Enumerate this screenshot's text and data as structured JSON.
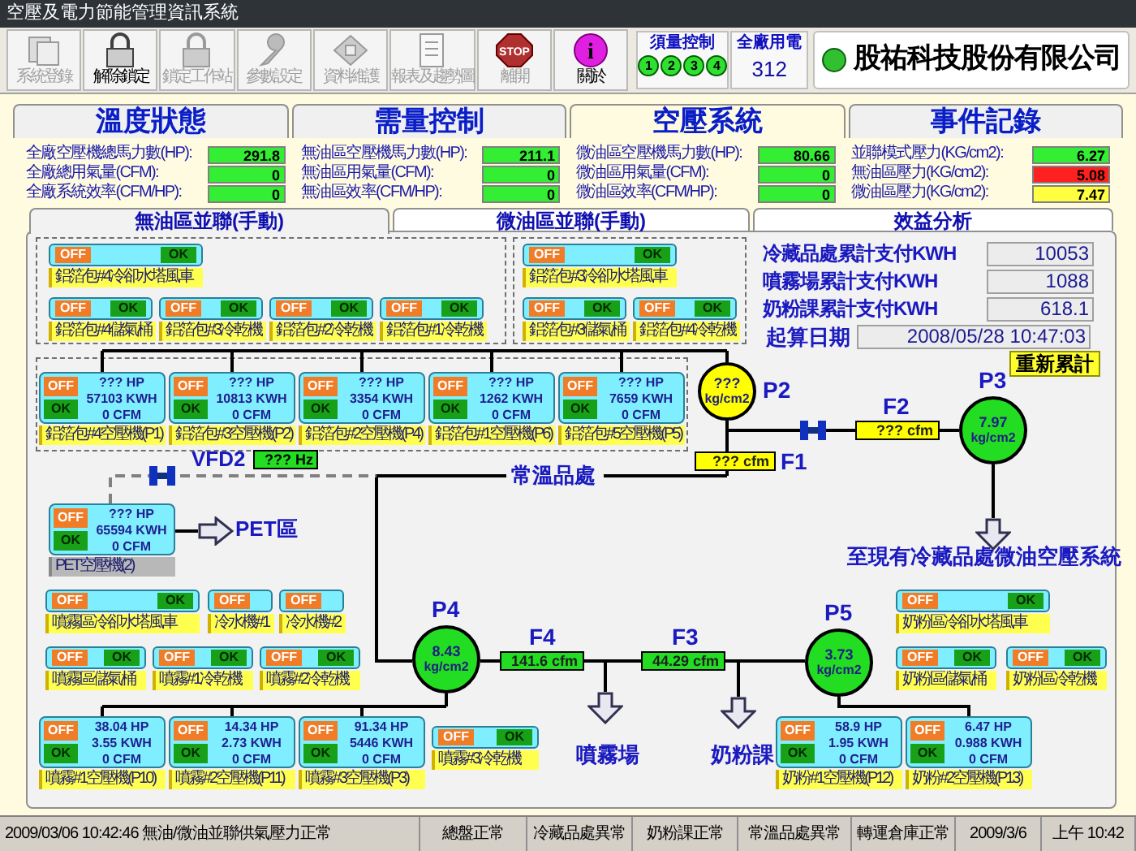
{
  "window": {
    "title": "空壓及電力節能管理資訊系統"
  },
  "toolbar": [
    {
      "label": "系統登錄",
      "kind": "documents",
      "disabled": true
    },
    {
      "label": "解除鎖定",
      "kind": "lock",
      "disabled": false
    },
    {
      "label": "鎖定工作站",
      "kind": "lock",
      "disabled": true
    },
    {
      "label": "參數設定",
      "kind": "wrench",
      "disabled": true
    },
    {
      "label": "資料維護",
      "kind": "disk",
      "disabled": true
    },
    {
      "label": "報表及趨勢圖",
      "kind": "page",
      "disabled": true
    },
    {
      "label": "離開",
      "kind": "stop",
      "icon_text": "STOP",
      "disabled": true
    },
    {
      "label": "關於",
      "kind": "info",
      "icon_text": "i",
      "disabled": false
    }
  ],
  "demand_control": {
    "label": "須量控制",
    "stages": [
      {
        "label": "1",
        "on": true
      },
      {
        "label": "2",
        "on": true
      },
      {
        "label": "3",
        "on": true
      },
      {
        "label": "4",
        "on": true
      }
    ]
  },
  "plant_power": {
    "label": "全廠用電",
    "value": "312"
  },
  "company": {
    "name": "股祐科技股份有限公司"
  },
  "tabs": [
    {
      "label": "溫度狀態",
      "selected": false
    },
    {
      "label": "需量控制",
      "selected": false
    },
    {
      "label": "空壓系統",
      "selected": true
    },
    {
      "label": "事件記錄",
      "selected": false
    }
  ],
  "metrics": [
    [
      {
        "label": "全廠空壓機總馬力數(HP):",
        "value": "291.8",
        "color": "#33ee33"
      },
      {
        "label": "全廠總用氣量(CFM):",
        "value": "0",
        "color": "#33ee33"
      },
      {
        "label": "全廠系統效率(CFM/HP):",
        "value": "0",
        "color": "#33ee33"
      }
    ],
    [
      {
        "label": "無油區空壓機馬力數(HP):",
        "value": "211.1",
        "color": "#33ee33"
      },
      {
        "label": "無油區用氣量(CFM):",
        "value": "0",
        "color": "#33ee33"
      },
      {
        "label": "無油區效率(CFM/HP):",
        "value": "0",
        "color": "#33ee33"
      }
    ],
    [
      {
        "label": "微油區空壓機馬力數(HP):",
        "value": "80.66",
        "color": "#33ee33"
      },
      {
        "label": "微油區用氣量(CFM):",
        "value": "0",
        "color": "#33ee33"
      },
      {
        "label": "微油區效率(CFM/HP):",
        "value": "0",
        "color": "#33ee33"
      }
    ],
    [
      {
        "label": "並聯模式壓力(KG/cm2):",
        "value": "6.27",
        "color": "#33ee33"
      },
      {
        "label": "無油區壓力(KG/cm2):",
        "value": "5.08",
        "color": "#ff2020"
      },
      {
        "label": "微油區壓力(KG/cm2):",
        "value": "7.47",
        "color": "#ffff40"
      }
    ]
  ],
  "subtabs": [
    {
      "label": "無油區並聯(手動)",
      "selected": true
    },
    {
      "label": "微油區並聯(手動)",
      "selected": false
    },
    {
      "label": "效益分析",
      "selected": false
    }
  ],
  "top_switches": [
    {
      "off": "OFF",
      "ok": "OK",
      "label": "鋁箔包#4冷卻水塔風車"
    },
    {
      "off": "OFF",
      "ok": "OK",
      "label": "鋁箔包#4儲氣桶"
    },
    {
      "off": "OFF",
      "ok": "OK",
      "label": "鋁箔包#3冷乾機"
    },
    {
      "off": "OFF",
      "ok": "OK",
      "label": "鋁箔包#2冷乾機"
    },
    {
      "off": "OFF",
      "ok": "OK",
      "label": "鋁箔包#1冷乾機"
    },
    {
      "off": "OFF",
      "ok": "OK",
      "label": "鋁箔包#3冷卻水塔風車"
    },
    {
      "off": "OFF",
      "ok": "OK",
      "label": "鋁箔包#3儲氣桶"
    },
    {
      "off": "OFF",
      "ok": "OK",
      "label": "鋁箔包#4冷乾機"
    }
  ],
  "top_compressors": [
    {
      "off": "OFF",
      "ok": "OK",
      "hp": "??? HP",
      "kwh": "57103 KWH",
      "cfm": "0 CFM",
      "label": "鋁箔包#4空壓機(P1)",
      "offline": false
    },
    {
      "off": "OFF",
      "ok": "OK",
      "hp": "??? HP",
      "kwh": "10813 KWH",
      "cfm": "0 CFM",
      "label": "鋁箔包#3空壓機(P2)",
      "offline": false
    },
    {
      "off": "OFF",
      "ok": "OK",
      "hp": "??? HP",
      "kwh": "3354 KWH",
      "cfm": "0 CFM",
      "label": "鋁箔包#2空壓機(P4)",
      "offline": false
    },
    {
      "off": "OFF",
      "ok": "OK",
      "hp": "??? HP",
      "kwh": "1262 KWH",
      "cfm": "0 CFM",
      "label": "鋁箔包#1空壓機(P6)",
      "offline": false
    },
    {
      "off": "OFF",
      "ok": "OK",
      "hp": "??? HP",
      "kwh": "7659 KWH",
      "cfm": "0 CFM",
      "label": "鋁箔包#5空壓機(P5)",
      "offline": false
    }
  ],
  "pet_compressor": {
    "off": "OFF",
    "ok": "OK",
    "hp": "??? HP",
    "kwh": "65594 KWH",
    "cfm": "0 CFM",
    "label": "PET空壓機(2)",
    "offline": true
  },
  "vfd": {
    "name": "VFD2",
    "value": "??? Hz"
  },
  "spray_switches": [
    {
      "off": "OFF",
      "ok": "OK",
      "label": "噴霧區冷卻水塔風車"
    },
    {
      "off": "OFF",
      "label": "冷水機#1"
    },
    {
      "off": "OFF",
      "label": "冷水機#2"
    },
    {
      "off": "OFF",
      "ok": "OK",
      "label": "噴霧區儲氣桶"
    },
    {
      "off": "OFF",
      "ok": "OK",
      "label": "噴霧#1冷乾機"
    },
    {
      "off": "OFF",
      "ok": "OK",
      "label": "噴霧#2冷乾機"
    },
    {
      "off": "OFF",
      "ok": "OK",
      "label": "噴霧#3冷乾機"
    }
  ],
  "spray_compressors": [
    {
      "off": "OFF",
      "ok": "OK",
      "hp": "38.04 HP",
      "kwh": "3.55 KWH",
      "cfm": "0 CFM",
      "label": "噴霧#1空壓機(P10)",
      "offline": false
    },
    {
      "off": "OFF",
      "ok": "OK",
      "hp": "14.34 HP",
      "kwh": "2.73 KWH",
      "cfm": "0 CFM",
      "label": "噴霧#2空壓機(P11)",
      "offline": false
    },
    {
      "off": "OFF",
      "ok": "OK",
      "hp": "91.34 HP",
      "kwh": "5446 KWH",
      "cfm": "0 CFM",
      "label": "噴霧#3空壓機(P3)",
      "offline": false
    }
  ],
  "milk_switches": [
    {
      "off": "OFF",
      "ok": "OK",
      "label": "奶粉區冷卻水塔風車"
    },
    {
      "off": "OFF",
      "ok": "OK",
      "label": "奶粉區儲氣桶"
    },
    {
      "off": "OFF",
      "ok": "OK",
      "label": "奶粉區冷乾機"
    }
  ],
  "milk_compressors": [
    {
      "off": "OFF",
      "ok": "OK",
      "hp": "58.9 HP",
      "kwh": "1.95 KWH",
      "cfm": "0 CFM",
      "label": "奶粉#1空壓機(P12)",
      "offline": false
    },
    {
      "off": "OFF",
      "ok": "OK",
      "hp": "6.47 HP",
      "kwh": "0.988 KWH",
      "cfm": "0 CFM",
      "label": "奶粉#2空壓機(P13)",
      "offline": false
    }
  ],
  "pressure_nodes": [
    {
      "name": "P2",
      "value": "???",
      "unit": "kg/cm2",
      "color": "#ffff00"
    },
    {
      "name": "P3",
      "value": "7.97",
      "unit": "kg/cm2",
      "color": "#22dd22"
    },
    {
      "name": "P4",
      "value": "8.43",
      "unit": "kg/cm2",
      "color": "#22dd22"
    },
    {
      "name": "P5",
      "value": "3.73",
      "unit": "kg/cm2",
      "color": "#22dd22"
    }
  ],
  "flow_meters": [
    {
      "name": "F1",
      "value": "??? cfm",
      "color": "#ffff00"
    },
    {
      "name": "F2",
      "value": "??? cfm",
      "color": "#ffff00"
    },
    {
      "name": "F4",
      "value": "141.6 cfm",
      "color": "#22dd22"
    },
    {
      "name": "F3",
      "value": "44.29 cfm",
      "color": "#22dd22"
    }
  ],
  "destinations": [
    "常溫品處",
    "PET區",
    "至現有冷藏品處微油空壓系統",
    "噴霧場",
    "奶粉課"
  ],
  "analysis": {
    "rows": [
      {
        "label": "冷藏品處累計支付KWH",
        "value": "10053"
      },
      {
        "label": "噴霧場累計支付KWH",
        "value": "1088"
      },
      {
        "label": "奶粉課累計支付KWH",
        "value": "618.1"
      }
    ],
    "start_date": {
      "label": "起算日期",
      "value": "2008/05/28 10:47:03"
    },
    "reset_button": "重新累計"
  },
  "status_bar": [
    "2009/03/06 10:42:46 無油/微油並聯供氣壓力正常",
    "總盤正常",
    "冷藏品處異常",
    "奶粉課正常",
    "常溫品處異常",
    "轉運倉庫正常",
    "2009/3/6",
    "上午 10:42"
  ]
}
